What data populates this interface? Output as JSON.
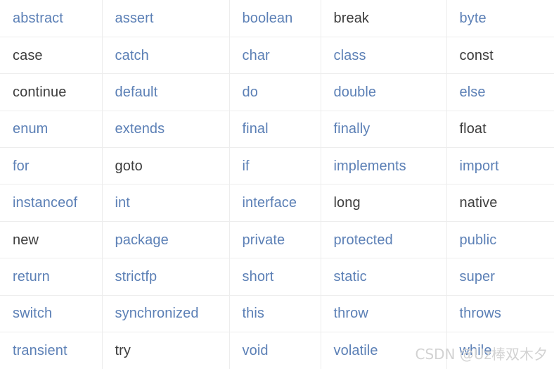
{
  "table": {
    "columns": 5,
    "rows": 10,
    "colors": {
      "keyword_blue": "#5c80b6",
      "keyword_dark": "#3d3d3d",
      "border": "#ededed",
      "background": "#ffffff",
      "watermark": "#d2d2d2"
    },
    "cells": [
      [
        {
          "text": "abstract",
          "style": "blue"
        },
        {
          "text": "assert",
          "style": "blue"
        },
        {
          "text": "boolean",
          "style": "blue"
        },
        {
          "text": "break",
          "style": "dark"
        },
        {
          "text": "byte",
          "style": "blue"
        }
      ],
      [
        {
          "text": "case",
          "style": "dark"
        },
        {
          "text": "catch",
          "style": "blue"
        },
        {
          "text": "char",
          "style": "blue"
        },
        {
          "text": "class",
          "style": "blue"
        },
        {
          "text": "const",
          "style": "dark"
        }
      ],
      [
        {
          "text": "continue",
          "style": "dark"
        },
        {
          "text": "default",
          "style": "blue"
        },
        {
          "text": "do",
          "style": "blue"
        },
        {
          "text": "double",
          "style": "blue"
        },
        {
          "text": "else",
          "style": "blue"
        }
      ],
      [
        {
          "text": "enum",
          "style": "blue"
        },
        {
          "text": "extends",
          "style": "blue"
        },
        {
          "text": "final",
          "style": "blue"
        },
        {
          "text": "finally",
          "style": "blue"
        },
        {
          "text": "float",
          "style": "dark"
        }
      ],
      [
        {
          "text": "for",
          "style": "blue"
        },
        {
          "text": "goto",
          "style": "dark"
        },
        {
          "text": "if",
          "style": "blue"
        },
        {
          "text": "implements",
          "style": "blue"
        },
        {
          "text": "import",
          "style": "blue"
        }
      ],
      [
        {
          "text": "instanceof",
          "style": "blue"
        },
        {
          "text": "int",
          "style": "blue"
        },
        {
          "text": "interface",
          "style": "blue"
        },
        {
          "text": "long",
          "style": "dark"
        },
        {
          "text": "native",
          "style": "dark"
        }
      ],
      [
        {
          "text": "new",
          "style": "dark"
        },
        {
          "text": "package",
          "style": "blue"
        },
        {
          "text": "private",
          "style": "blue"
        },
        {
          "text": "protected",
          "style": "blue"
        },
        {
          "text": "public",
          "style": "blue"
        }
      ],
      [
        {
          "text": "return",
          "style": "blue"
        },
        {
          "text": "strictfp",
          "style": "blue"
        },
        {
          "text": "short",
          "style": "blue"
        },
        {
          "text": "static",
          "style": "blue"
        },
        {
          "text": "super",
          "style": "blue"
        }
      ],
      [
        {
          "text": "switch",
          "style": "blue"
        },
        {
          "text": "synchronized",
          "style": "blue"
        },
        {
          "text": "this",
          "style": "blue"
        },
        {
          "text": "throw",
          "style": "blue"
        },
        {
          "text": "throws",
          "style": "blue"
        }
      ],
      [
        {
          "text": "transient",
          "style": "blue"
        },
        {
          "text": "try",
          "style": "dark"
        },
        {
          "text": "void",
          "style": "blue"
        },
        {
          "text": "volatile",
          "style": "blue"
        },
        {
          "text": "while",
          "style": "blue"
        }
      ]
    ]
  },
  "watermark": {
    "text": "CSDN @Uz棒双木夕"
  }
}
